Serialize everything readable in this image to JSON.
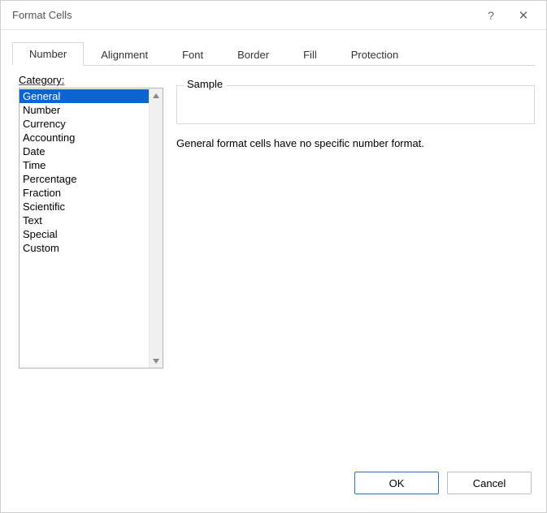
{
  "titlebar": {
    "title": "Format Cells"
  },
  "tabs": [
    {
      "label": "Number",
      "active": true
    },
    {
      "label": "Alignment",
      "active": false
    },
    {
      "label": "Font",
      "active": false
    },
    {
      "label": "Border",
      "active": false
    },
    {
      "label": "Fill",
      "active": false
    },
    {
      "label": "Protection",
      "active": false
    }
  ],
  "category": {
    "label": "Category:",
    "items": [
      "General",
      "Number",
      "Currency",
      "Accounting",
      "Date",
      "Time",
      "Percentage",
      "Fraction",
      "Scientific",
      "Text",
      "Special",
      "Custom"
    ],
    "selected_index": 0
  },
  "sample": {
    "legend": "Sample",
    "value": ""
  },
  "description": "General format cells have no specific number format.",
  "buttons": {
    "ok": "OK",
    "cancel": "Cancel"
  }
}
